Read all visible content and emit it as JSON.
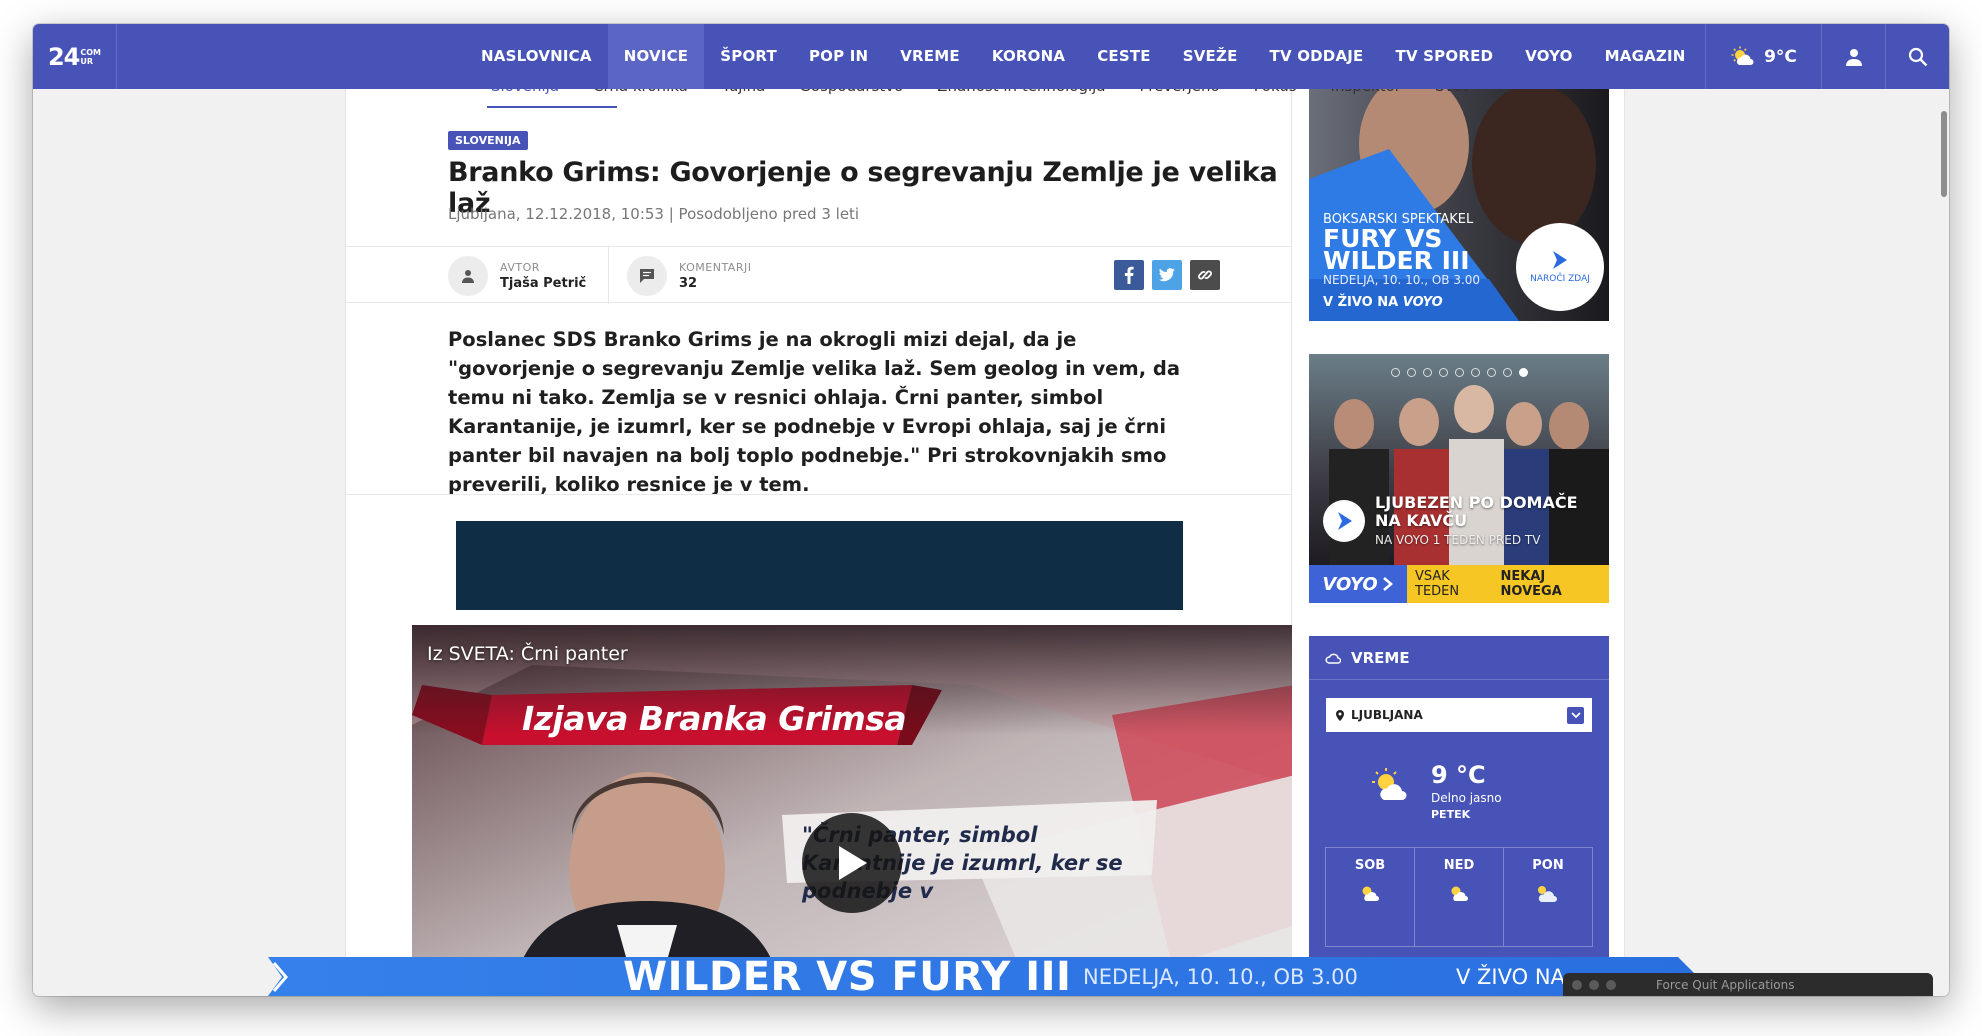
{
  "nav": {
    "logo_main": "24",
    "logo_sup_top": "COM",
    "logo_sup_bottom": "UR",
    "items": [
      {
        "label": "NASLOVNICA"
      },
      {
        "label": "NOVICE"
      },
      {
        "label": "ŠPORT"
      },
      {
        "label": "POP IN"
      },
      {
        "label": "VREME"
      },
      {
        "label": "KORONA"
      },
      {
        "label": "CESTE"
      },
      {
        "label": "SVEŽE"
      },
      {
        "label": "TV ODDAJE"
      },
      {
        "label": "TV SPORED"
      },
      {
        "label": "VOYO"
      },
      {
        "label": "MAGAZIN"
      }
    ],
    "active_index": 1,
    "temperature": "9°C"
  },
  "subnav": {
    "items": [
      "Slovenija",
      "Črna kronika",
      "Tujina",
      "Gospodarstvo",
      "Znanost in tehnologija",
      "Preverjeno",
      "Fokus",
      "Inšpektor",
      "Svet"
    ]
  },
  "article": {
    "category": "SLOVENIJA",
    "title": "Branko Grims: Govorjenje o segrevanju Zemlje je velika laž",
    "meta": "Ljubljana, 12.12.2018, 10:53 | Posodobljeno pred 3 leti",
    "author_label": "AVTOR",
    "author_name": "Tjaša Petrič",
    "comments_label": "KOMENTARJI",
    "comments_count": "32",
    "lead": "Poslanec SDS Branko Grims je na okrogli mizi dejal, da je \"govorjenje o segrevanju Zemlje velika laž. Sem geolog in vem, da temu ni tako. Zemlja se v resnici ohlaja. Črni panter, simbol Karantanije, je izumrl, ker se podnebje v Evropi ohlaja, saj je črni panter bil navajen na bolj toplo podnebje.\" Pri strokovnjakih smo preverili, koliko resnice je v tem."
  },
  "video": {
    "title": "Iz SVETA: Črni panter",
    "banner": "Izjava Branka Grimsa",
    "quote": "\"Črni panter, simbol Karantnije je izumrl, ker se podnebje v"
  },
  "sidebar": {
    "ad1": {
      "kicker": "BOKSARSKI SPEKTAKEL",
      "headline_1": "FURY VS",
      "headline_2": "WILDER III",
      "date": "NEDELJA, 10. 10., OB 3.00",
      "live": "V ŽIVO NA",
      "live_brand": "VOYO",
      "cta": "NAROČI ZDAJ"
    },
    "ad2": {
      "title": "LJUBEZEN PO DOMAČE NA KAVČU",
      "subtitle": "NA VOYO 1 TEDEN PRED TV",
      "brand": "VOYO",
      "tag_normal": "VSAK TEDEN",
      "tag_bold": "NEKAJ NOVEGA",
      "slides": 9,
      "active_slide": 9
    },
    "weather": {
      "header": "VREME",
      "location": "LJUBLJANA",
      "temp": "9 °C",
      "desc": "Delno jasno",
      "day": "PETEK",
      "forecast": [
        {
          "day": "SOB"
        },
        {
          "day": "NED"
        },
        {
          "day": "PON"
        }
      ]
    }
  },
  "bottom_banner": {
    "headline": "WILDER VS FURY III",
    "date": "NEDELJA, 10. 10., OB 3.00",
    "live": "V ŽIVO NA"
  },
  "overlay": {
    "force_quit": "Force Quit Applications"
  },
  "colors": {
    "brand": "#4753b7",
    "voyo_blue": "#3d63d6",
    "voyo_yellow": "#f6c624",
    "ad_navy": "#0f2e45",
    "banner_blue": "#2f7be6"
  }
}
